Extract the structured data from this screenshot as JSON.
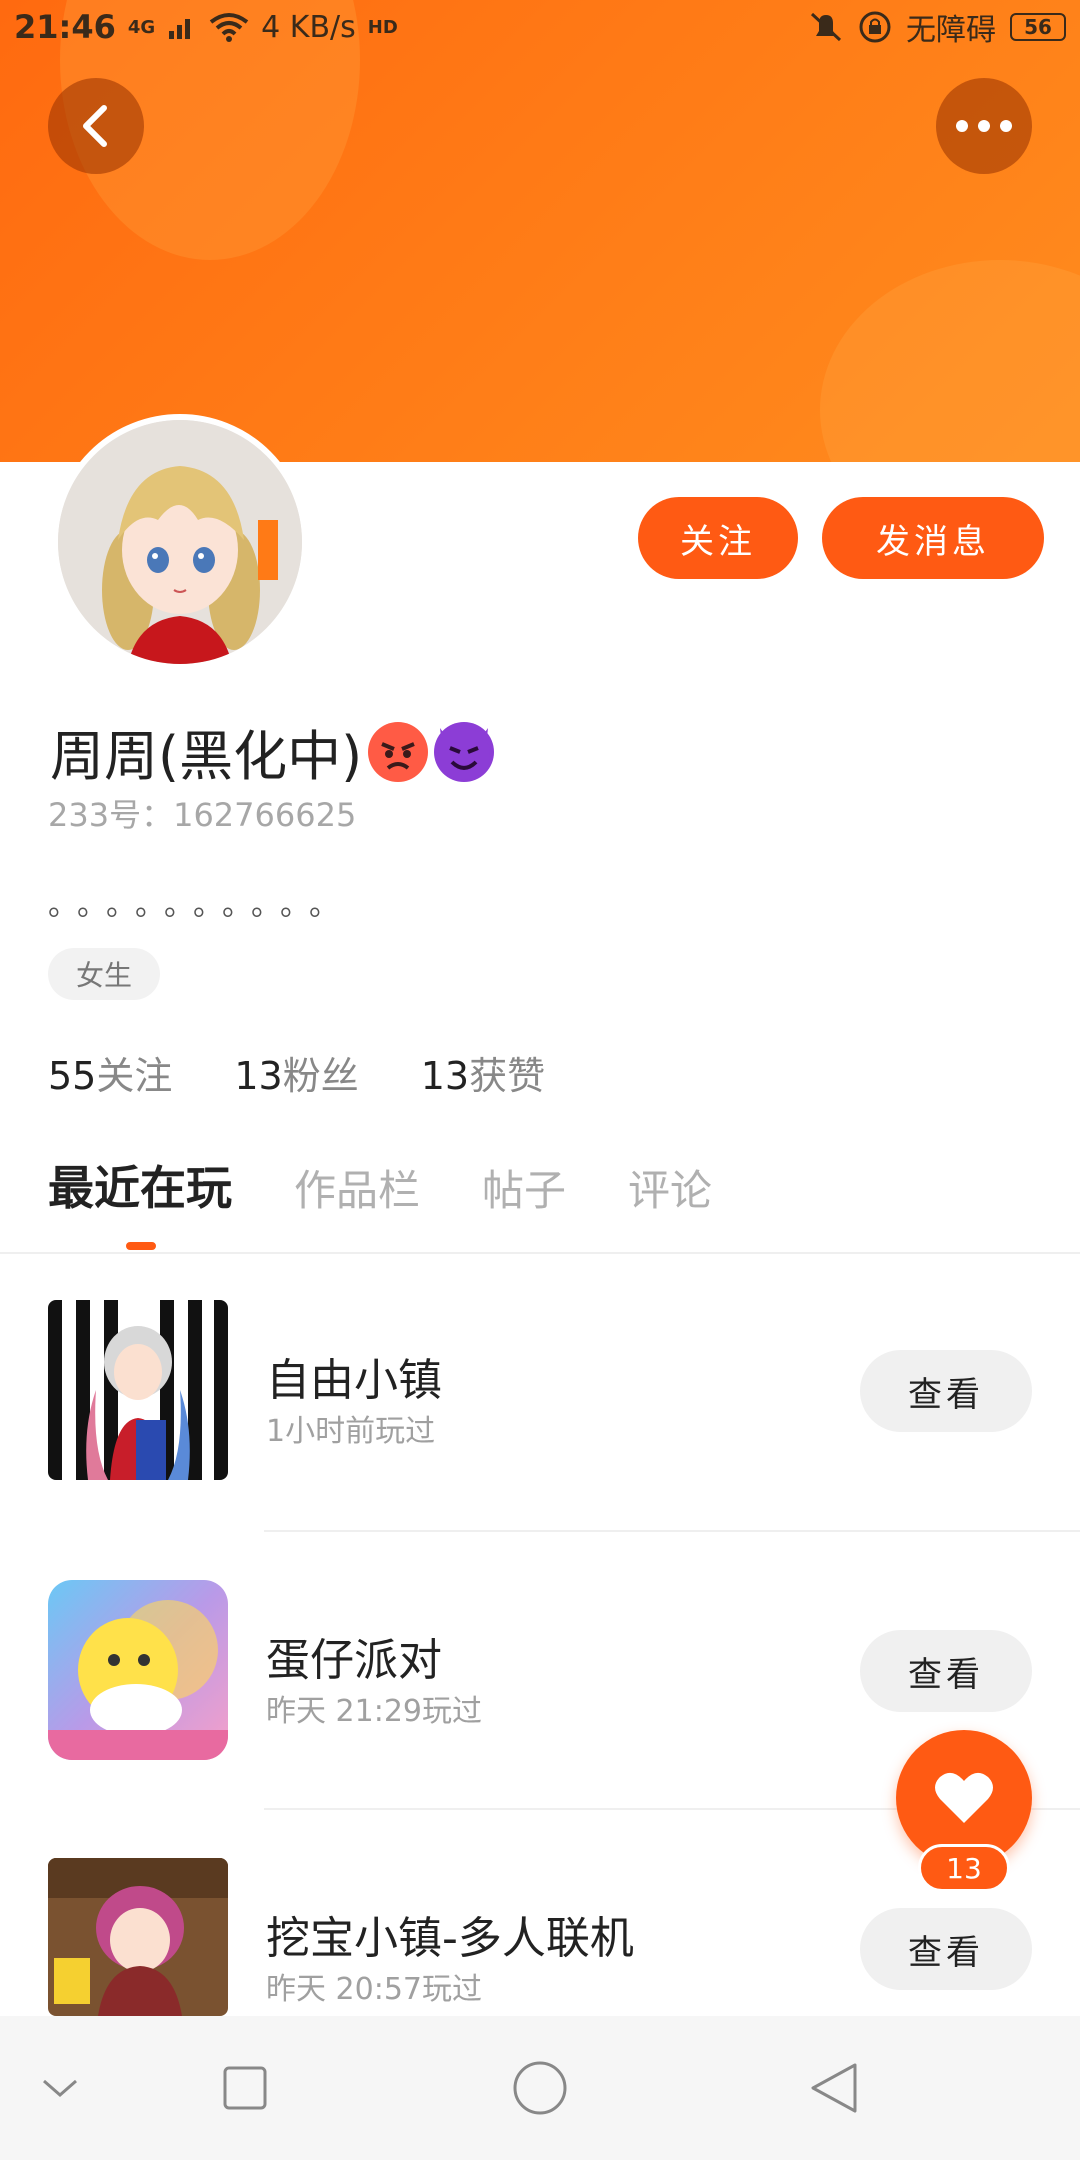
{
  "status_bar": {
    "time": "21:46",
    "network_type": "4G",
    "speed": "4 KB/s",
    "hd": "HD",
    "accessibility": "无障碍",
    "battery": "56"
  },
  "profile": {
    "nickname": "周周(黑化中)",
    "emoji_icons": [
      "angry-face-icon",
      "smiling-devil-icon"
    ],
    "uid": "233号：162766625",
    "bio": "。。。。。。。。。。",
    "gender_tag": "女生",
    "stats": {
      "following_num": "55",
      "following_label": "关注",
      "fans_num": "13",
      "fans_label": "粉丝",
      "likes_num": "13",
      "likes_label": "获赞"
    }
  },
  "actions": {
    "follow": "关注",
    "message": "发消息"
  },
  "tabs": [
    {
      "label": "最近在玩",
      "active": true
    },
    {
      "label": "作品栏",
      "active": false
    },
    {
      "label": "帖子",
      "active": false
    },
    {
      "label": "评论",
      "active": false
    }
  ],
  "games": [
    {
      "title": "自由小镇",
      "subtitle": "1小时前玩过",
      "button": "查看"
    },
    {
      "title": "蛋仔派对",
      "subtitle": "昨天 21:29玩过",
      "button": "查看"
    },
    {
      "title": "挖宝小镇-多人联机",
      "subtitle": "昨天 20:57玩过",
      "button": "查看"
    }
  ],
  "like_fab": {
    "count": "13",
    "icon": "heart-icon"
  },
  "colors": {
    "accent": "#ff5a13",
    "banner": "#ff7a16"
  },
  "nav_icons": [
    "chevron-down-icon",
    "square-icon",
    "circle-icon",
    "triangle-back-icon"
  ]
}
